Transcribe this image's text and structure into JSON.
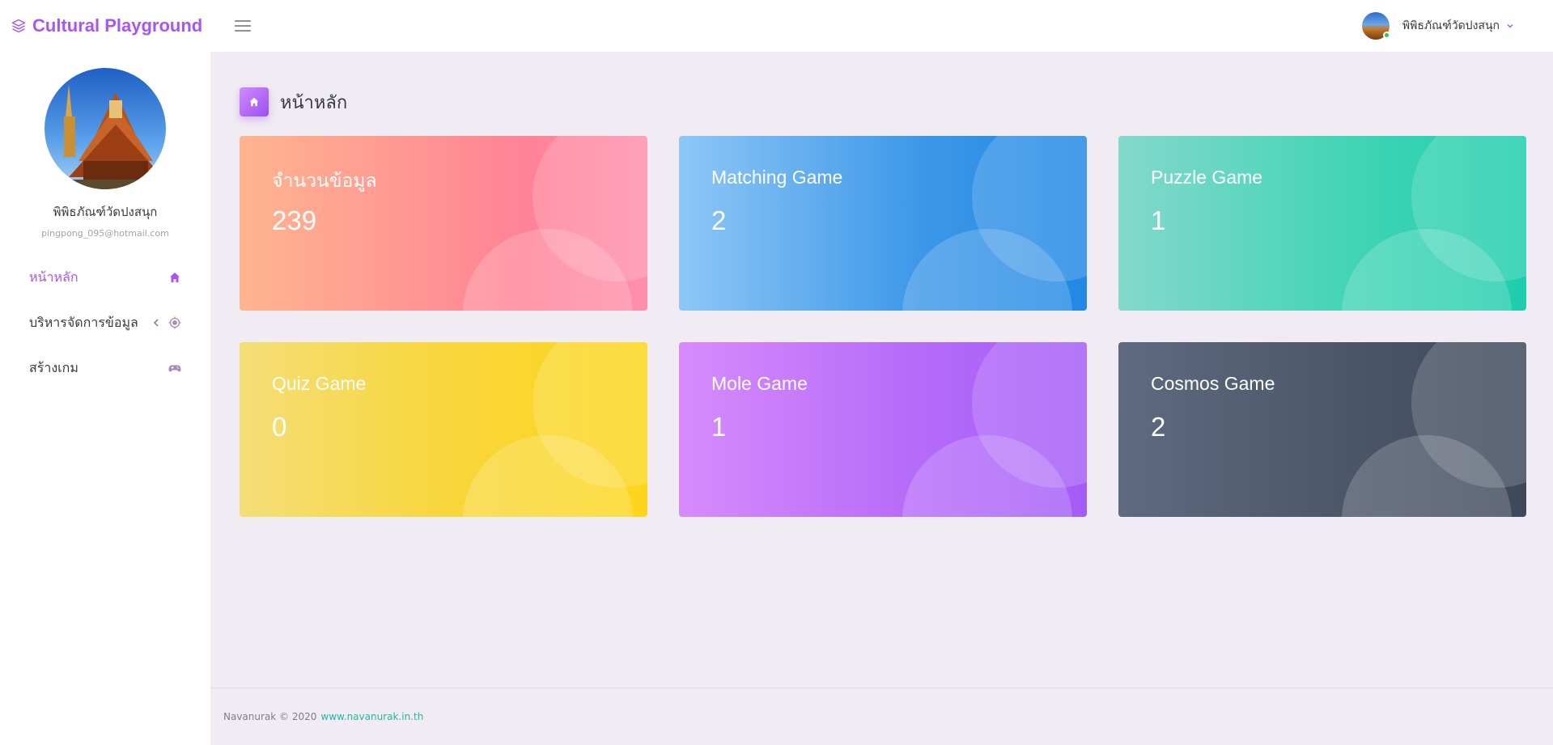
{
  "app": {
    "brand": "Cultural Playground",
    "brand_color": "#a855f7"
  },
  "topbar": {
    "user_name": "พิพิธภัณฑ์วัดปงสนุก",
    "status_color": "#22c55e"
  },
  "sidebar": {
    "profile_name": "พิพิธภัณฑ์วัดปงสนุก",
    "profile_email": "pingpong_095@hotmail.com",
    "items": [
      {
        "label": "หน้าหลัก",
        "icon": "home-icon",
        "active": true
      },
      {
        "label": "บริหารจัดการข้อมูล",
        "icon": "target-icon",
        "active": false
      },
      {
        "label": "สร้างเกม",
        "icon": "gamepad-icon",
        "active": false
      }
    ]
  },
  "main": {
    "page_title": "หน้าหลัก",
    "cards": [
      {
        "title": "จำนวนข้อมูล",
        "value": "239"
      },
      {
        "title": "Matching Game",
        "value": "2"
      },
      {
        "title": "Puzzle Game",
        "value": "1"
      },
      {
        "title": "Quiz Game",
        "value": "0"
      },
      {
        "title": "Mole Game",
        "value": "1"
      },
      {
        "title": "Cosmos Game",
        "value": "2"
      }
    ]
  },
  "footer": {
    "text": "Navanurak © 2020",
    "link": "www.navanurak.in.th",
    "link_color": "#22b7a0"
  }
}
